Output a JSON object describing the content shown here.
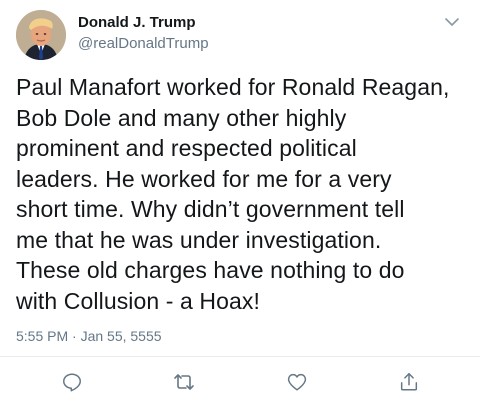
{
  "author": {
    "display_name": "Donald J. Trump",
    "handle": "@realDonaldTrump",
    "avatar_icon": "profile-photo"
  },
  "tweet": {
    "text": "Paul Manafort worked for Ronald Reagan,\nBob Dole and many other highly\nprominent and respected political\nleaders. He worked for me for a very\nshort time. Why didn’t government tell\nme that he was under investigation.\nThese old charges have nothing to do\nwith Collusion - a Hoax!",
    "timestamp": "5:55 PM · Jan 55, 5555"
  },
  "actions": {
    "reply_icon": "reply-icon",
    "retweet_icon": "retweet-icon",
    "like_icon": "heart-icon",
    "share_icon": "share-icon"
  },
  "colors": {
    "text": "#14171a",
    "secondary": "#657786",
    "divider": "#e6ecf0",
    "icon": "#657786"
  }
}
